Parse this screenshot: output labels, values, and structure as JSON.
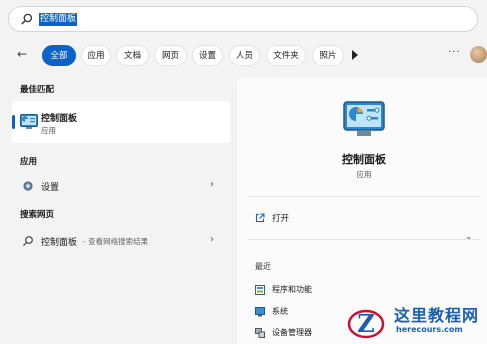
{
  "search": {
    "query": "控制面板"
  },
  "filters": {
    "tabs": [
      "全部",
      "应用",
      "文档",
      "网页",
      "设置",
      "人员",
      "文件夹",
      "照片"
    ],
    "active_index": 0
  },
  "left": {
    "best_match_heading": "最佳匹配",
    "best_match": {
      "title": "控制面板",
      "subtitle": "应用"
    },
    "apps_heading": "应用",
    "apps": [
      {
        "label": "设置"
      }
    ],
    "web_heading": "搜索网页",
    "web": {
      "label": "控制面板",
      "suffix": " - 查看网络搜索结果"
    }
  },
  "detail": {
    "title": "控制面板",
    "subtitle": "应用",
    "open_label": "打开",
    "recent_heading": "最近",
    "recent": [
      "程序和功能",
      "系统",
      "设备管理器"
    ]
  },
  "watermark": {
    "title": "这里教程网",
    "url": "herecours.com"
  },
  "colors": {
    "accent": "#0a64c8",
    "watermark": "#1b5fae"
  },
  "icons": [
    "search-icon",
    "back-arrow-icon",
    "play-more-icon",
    "ellipsis-icon",
    "control-panel-icon",
    "gear-icon",
    "chevron-right-icon",
    "open-external-icon",
    "chevron-down-icon"
  ]
}
